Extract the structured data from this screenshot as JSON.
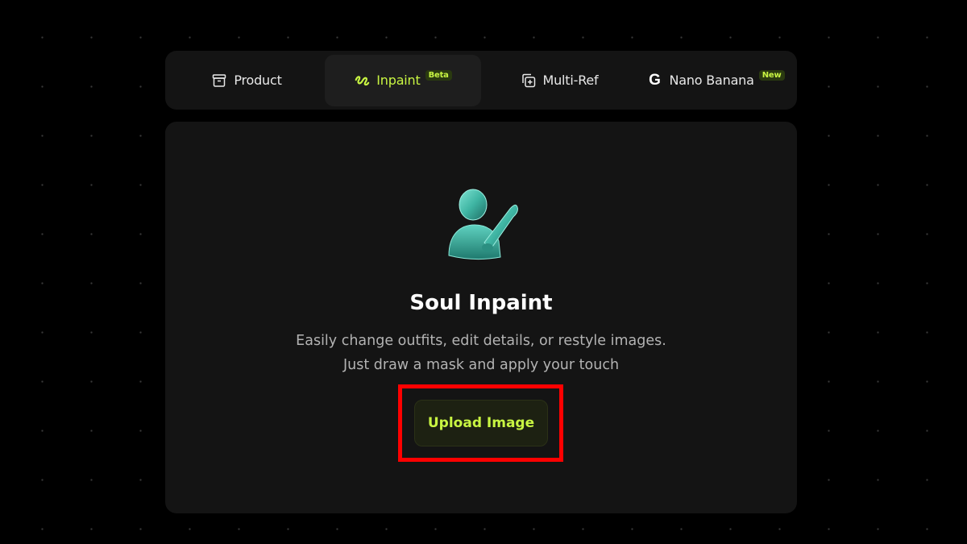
{
  "tabs": [
    {
      "label": "Product",
      "icon": "archive-box-icon"
    },
    {
      "label": "Inpaint",
      "icon": "squiggle-icon",
      "badge": "Beta"
    },
    {
      "label": "Multi-Ref",
      "icon": "layers-plus-icon"
    },
    {
      "label": "Nano Banana",
      "icon": "google-g-icon",
      "icon_glyph": "G",
      "badge": "New"
    }
  ],
  "panel": {
    "icon": "person-brush-icon",
    "title": "Soul Inpaint",
    "description_line1": "Easily change outfits, edit details, or restyle images.",
    "description_line2": "Just draw a mask and apply your touch",
    "upload_label": "Upload Image"
  },
  "colors": {
    "accent": "#c8f542",
    "background": "#000000",
    "panel": "#141414",
    "highlight": "#ff0000"
  }
}
